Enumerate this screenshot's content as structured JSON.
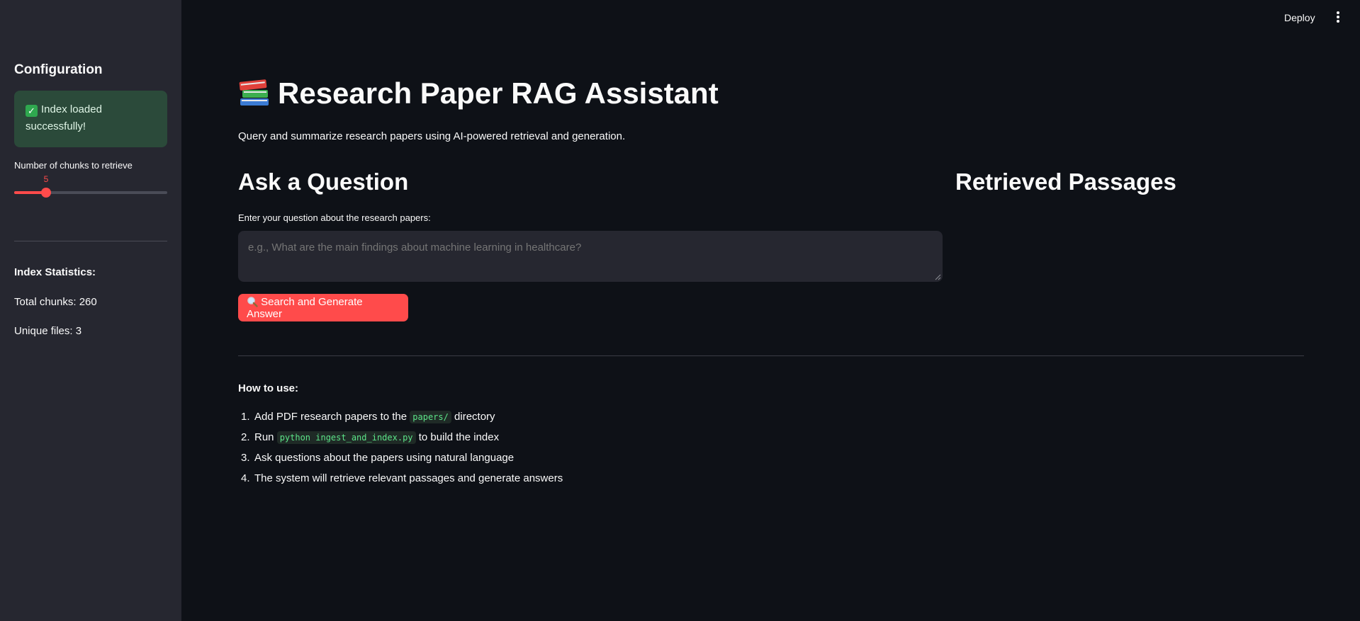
{
  "header": {
    "deploy_label": "Deploy",
    "menu_icon": "kebab-menu-icon"
  },
  "sidebar": {
    "title": "Configuration",
    "alert": {
      "icon": "check-icon",
      "text": "Index loaded successfully!"
    },
    "slider": {
      "label": "Number of chunks to retrieve",
      "value": "5",
      "min": 1,
      "max": 20
    },
    "stats": {
      "title": "Index Statistics:",
      "total_chunks": "Total chunks: 260",
      "unique_files": "Unique files: 3"
    }
  },
  "main": {
    "title_icon": "books-icon",
    "title": "Research Paper RAG Assistant",
    "subtitle": "Query and summarize research papers using AI-powered retrieval and generation.",
    "ask_heading": "Ask a Question",
    "retrieved_heading": "Retrieved Passages",
    "input_label": "Enter your question about the research papers:",
    "input_placeholder": "e.g., What are the main findings about machine learning in healthcare?",
    "input_value": "",
    "search_button": {
      "icon": "magnifier-icon",
      "label": "Search and Generate Answer"
    },
    "howto": {
      "title": "How to use:",
      "steps": [
        {
          "num": "1.",
          "before": "Add PDF research papers to the ",
          "code": "papers/",
          "after": " directory"
        },
        {
          "num": "2.",
          "before": "Run ",
          "code": "python ingest_and_index.py",
          "after": " to build the index"
        },
        {
          "num": "3.",
          "text": "Ask questions about the papers using natural language"
        },
        {
          "num": "4.",
          "text": "The system will retrieve relevant passages and generate answers"
        }
      ]
    }
  },
  "colors": {
    "background": "#0e1117",
    "sidebar": "#262730",
    "accent": "#ff4b4b",
    "success_bg": "#2b4a3a",
    "code": "#5ce488"
  }
}
